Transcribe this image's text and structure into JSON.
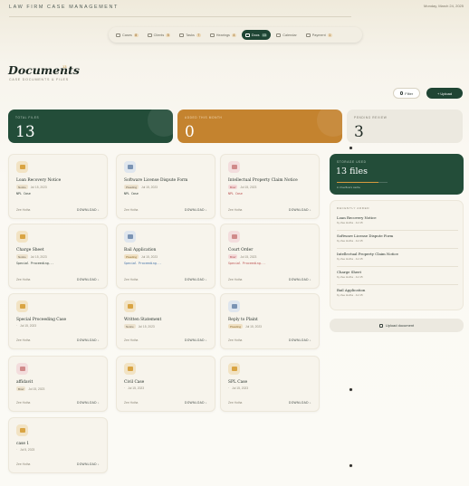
{
  "header": {
    "app_title": "LAW FIRM CASE MANAGEMENT",
    "date": "Monday, March 24, 2025"
  },
  "nav": [
    {
      "label": "Cases",
      "count": "8",
      "icon": "briefcase-icon"
    },
    {
      "label": "Clients",
      "count": "5",
      "icon": "people-icon"
    },
    {
      "label": "Tasks",
      "count": "7",
      "icon": "check-icon"
    },
    {
      "label": "Hearings",
      "count": "4",
      "icon": "calendar-icon"
    },
    {
      "label": "Docs",
      "count": "13",
      "icon": "document-icon",
      "active": true
    },
    {
      "label": "Calendar",
      "count": "",
      "icon": "calendar-icon"
    },
    {
      "label": "Payment",
      "count": "1",
      "icon": "card-icon"
    }
  ],
  "page": {
    "title": "Documents",
    "title_badge": "13",
    "subtitle": "CASE DOCUMENTS & FILES",
    "filter_label": "Filter",
    "upload_label": "+ Upload"
  },
  "stats": [
    {
      "label": "TOTAL FILES",
      "value": "13"
    },
    {
      "label": "ADDED THIS MONTH",
      "value": "0"
    },
    {
      "label": "PENDING REVIEW",
      "value": "3"
    }
  ],
  "documents": [
    {
      "name": "Loan Recovery Notice",
      "status": "Notice",
      "date": "Jul 15, 2023",
      "note": "NPL Case",
      "owner": "Zee Hotha",
      "icon": "folder-icon",
      "tone": "tan",
      "tag": "tan",
      "note_color": "#2b3a33"
    },
    {
      "name": "Software License Dispute Form",
      "status": "Pleading",
      "date": "Jul 15, 2023",
      "note": "NPL Case",
      "owner": "Zee Hotha",
      "icon": "document-icon",
      "tone": "blue",
      "tag": "tan",
      "note_color": "#2b3a33"
    },
    {
      "name": "Intellectual Property Claim Notice",
      "status": "Brief",
      "date": "Jul 15, 2023",
      "note": "NPL Case",
      "owner": "Zee Hotha",
      "icon": "document-icon",
      "tone": "pink",
      "tag": "pink",
      "note_color": "#b94a4a"
    },
    {
      "name": "Charge Sheet",
      "status": "Notice",
      "date": "Jul 15, 2023",
      "note": "Special Proceeding...",
      "owner": "Zee Hotha",
      "icon": "folder-icon",
      "tone": "tan",
      "tag": "tan",
      "note_color": "#2b3a33"
    },
    {
      "name": "Bail Application",
      "status": "Pleading",
      "date": "Jul 15, 2023",
      "note": "Special Proceeding...",
      "owner": "Zee Hotha",
      "icon": "document-icon",
      "tone": "blue",
      "tag": "sand",
      "note_color": "#3f6fa6"
    },
    {
      "name": "Court Order",
      "status": "Brief",
      "date": "Jul 15, 2023",
      "note": "Special Proceeding...",
      "owner": "Zee Hotha",
      "icon": "document-icon",
      "tone": "pink",
      "tag": "pink",
      "note_color": "#b94a4a"
    },
    {
      "name": "Special Proceeding Case",
      "status": "",
      "date": "Jul 15, 2023",
      "note": "",
      "owner": "Zee Hotha",
      "icon": "folder-icon",
      "tone": "tan",
      "tag": "tan",
      "note_color": "#2b3a33"
    },
    {
      "name": "Written Statement",
      "status": "Notice",
      "date": "Jul 15, 2023",
      "note": "",
      "owner": "Zee Hotha",
      "icon": "folder-icon",
      "tone": "tan",
      "tag": "tan",
      "note_color": "#2b3a33"
    },
    {
      "name": "Reply to Plaint",
      "status": "Pleading",
      "date": "Jul 15, 2023",
      "note": "",
      "owner": "Zee Hotha",
      "icon": "document-icon",
      "tone": "blue",
      "tag": "sand",
      "note_color": "#2b3a33"
    },
    {
      "name": "affidavit",
      "status": "Brief",
      "date": "Jul 15, 2023",
      "note": "",
      "owner": "Zee Hotha",
      "icon": "document-icon",
      "tone": "pink",
      "tag": "tan",
      "note_color": "#2b3a33"
    },
    {
      "name": "Civil Case",
      "status": "",
      "date": "Jul 15, 2023",
      "note": "",
      "owner": "Zee Hotha",
      "icon": "folder-icon",
      "tone": "tan",
      "tag": "tan",
      "note_color": "#2b3a33"
    },
    {
      "name": "SPL Case",
      "status": "",
      "date": "Jul 15, 2023",
      "note": "",
      "owner": "Zee Hotha",
      "icon": "folder-icon",
      "tone": "tan",
      "tag": "tan",
      "note_color": "#2b3a33"
    },
    {
      "name": "case 1",
      "status": "",
      "date": "Jul 5, 2023",
      "note": "",
      "owner": "Zee Hotha",
      "icon": "folder-icon",
      "tone": "tan",
      "tag": "tan",
      "note_color": "#2b3a33"
    }
  ],
  "download_label": "DOWNLOAD ↓",
  "storage": {
    "label": "STORAGE USED",
    "value": "13 files",
    "fill": 0.82,
    "note": "in Overflow's cache"
  },
  "recent": {
    "label": "RECENTLY ADDED",
    "items": [
      {
        "name": "Loan Recovery Notice",
        "meta": "by Zee Hotha · Jul 15"
      },
      {
        "name": "Software License Dispute Form",
        "meta": "by Zee Hotha · Jul 15"
      },
      {
        "name": "Intellectual Property Claim Notice",
        "meta": "by Zee Hotha · Jul 15"
      },
      {
        "name": "Charge Sheet",
        "meta": "by Zee Hotha · Jul 15"
      },
      {
        "name": "Bail Application",
        "meta": "by Zee Hotha · Jul 15"
      }
    ]
  },
  "upload_document_label": "Upload document",
  "colors": {
    "green": "#234d39",
    "orange": "#c4832f",
    "accent": "#1f4534"
  }
}
